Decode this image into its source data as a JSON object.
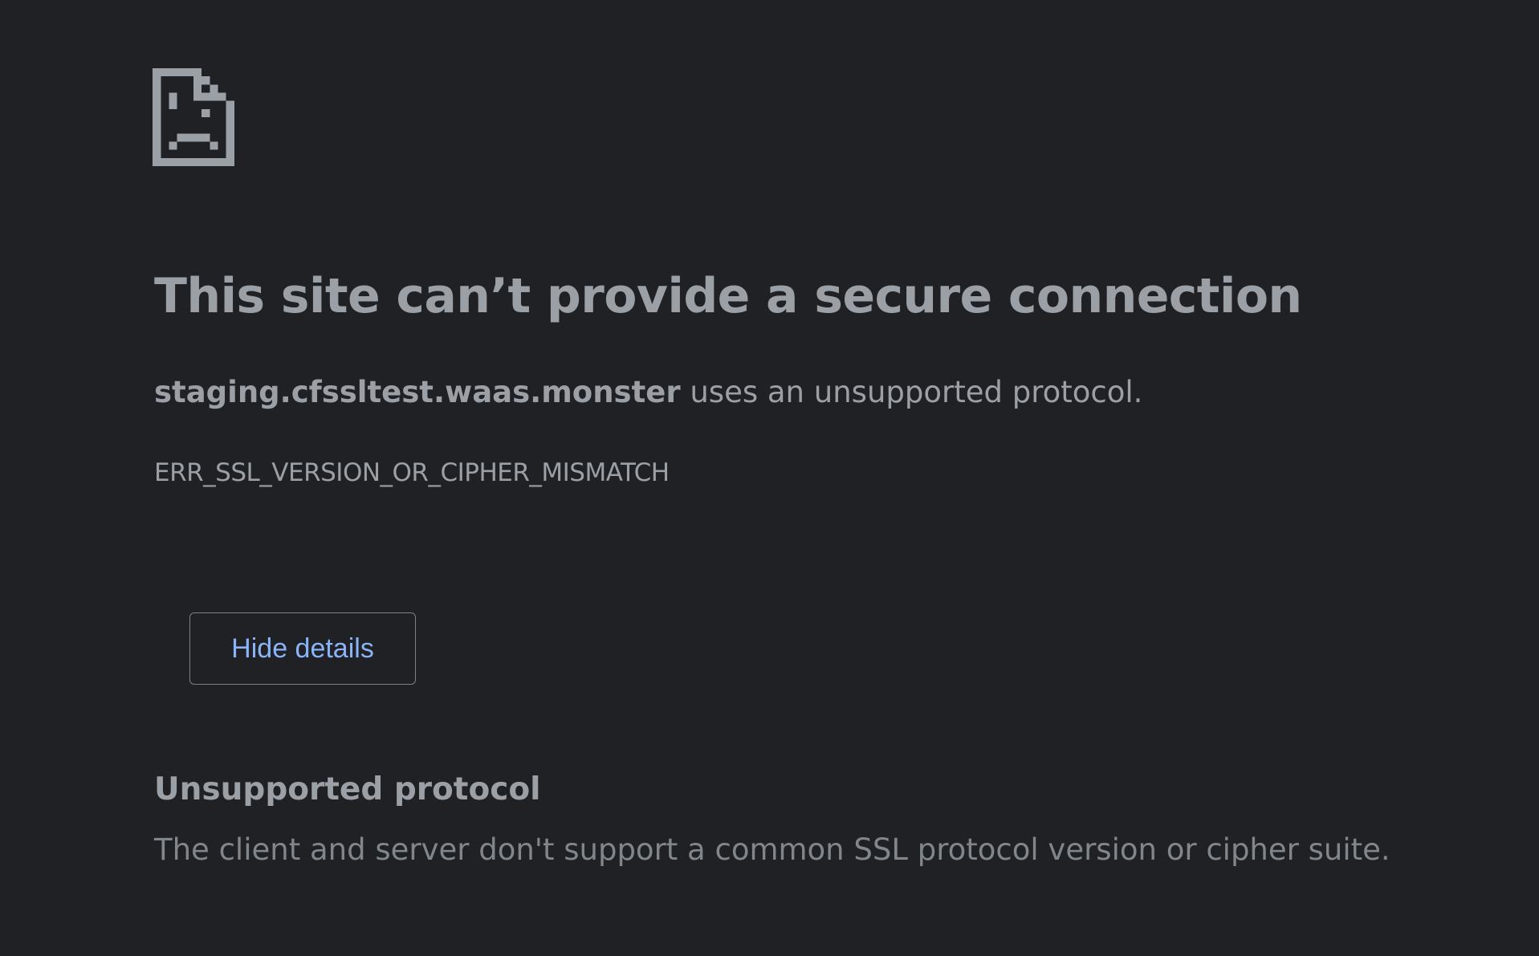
{
  "icon": "sad-page-icon",
  "colors": {
    "background": "#202124",
    "text": "#9aa0a6",
    "secondary_text": "#80868b",
    "link": "#8ab4f8"
  },
  "main": {
    "title": "This site can’t provide a secure connection",
    "summary": {
      "domain": "staging.cfssltest.waas.monster",
      "message": " uses an unsupported protocol."
    },
    "error_code": "ERR_SSL_VERSION_OR_CIPHER_MISMATCH",
    "details_button_label": "Hide details"
  },
  "details": {
    "heading": "Unsupported protocol",
    "text": "The client and server don't support a common SSL protocol version or cipher suite."
  }
}
